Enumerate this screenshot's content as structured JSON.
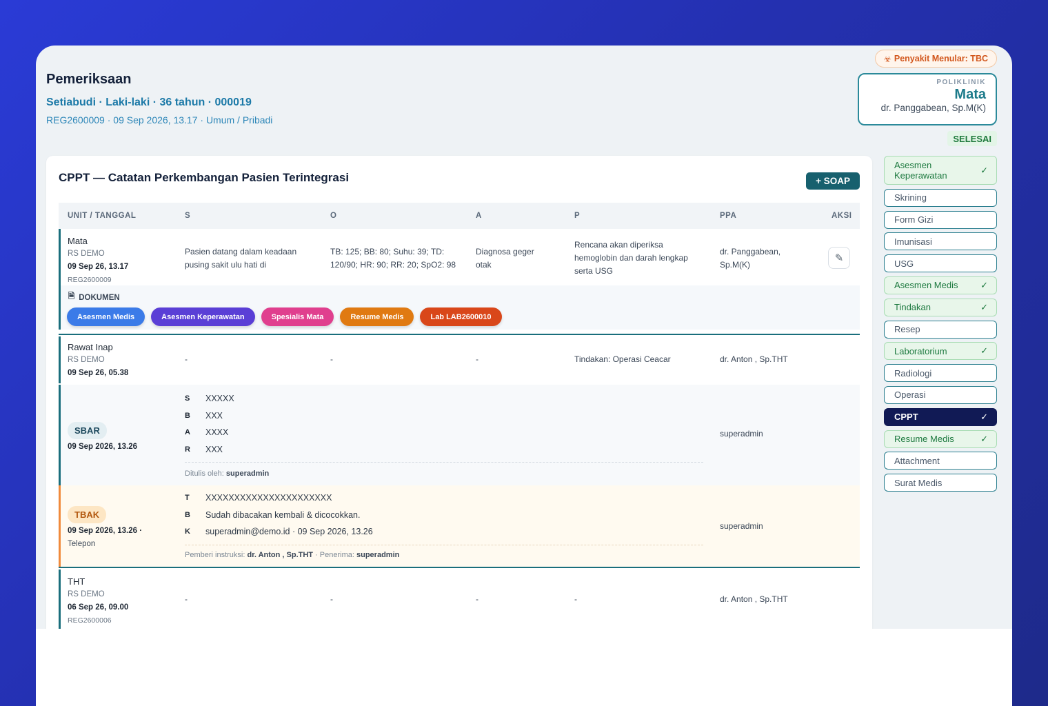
{
  "page": {
    "title": "Pemeriksaan",
    "patient_line": "Setiabudi · Laki-laki · 36 tahun · 000019",
    "reg_line": "REG2600009 · 09 Sep 2026, 13.17 · Umum / Pribadi"
  },
  "header_right": {
    "infection_badge": "Penyakit Menular: TBC",
    "poli_label": "POLIKLINIK",
    "poli_name": "Mata",
    "poli_doctor": "dr. Panggabean, Sp.M(K)",
    "status": "SELESAI"
  },
  "cppt": {
    "title": "CPPT — Catatan Perkembangan Pasien Terintegrasi",
    "soap_button": "+ SOAP",
    "columns": [
      "UNIT / TANGGAL",
      "S",
      "O",
      "A",
      "P",
      "PPA",
      "AKSI"
    ],
    "row1": {
      "unit": "Mata",
      "site": "RS DEMO",
      "date": "09 Sep 26, 13.17",
      "reg": "REG2600009",
      "s": "Pasien datang dalam keadaan pusing sakit ulu hati di",
      "o": "TB: 125; BB: 80; Suhu: 39; TD: 120/90; HR: 90; RR: 20; SpO2: 98",
      "a": "Diagnosa geger otak",
      "p": "Rencana akan diperiksa hemoglobin dan darah lengkap serta USG",
      "ppa": "dr. Panggabean, Sp.M(K)"
    },
    "documents": {
      "label": "DOKUMEN",
      "pills": [
        {
          "label": "Asesmen Medis",
          "color": "#3b7be8"
        },
        {
          "label": "Asesmen Keperawatan",
          "color": "#5a3fd6"
        },
        {
          "label": "Spesialis Mata",
          "color": "#e03f8e"
        },
        {
          "label": "Resume Medis",
          "color": "#e07a12"
        },
        {
          "label": "Lab LAB2600010",
          "color": "#d9471a"
        }
      ]
    },
    "row2": {
      "unit": "Rawat Inap",
      "site": "RS DEMO",
      "date": "09 Sep 26, 05.38",
      "s": "-",
      "o": "-",
      "a": "-",
      "p": "Tindakan: Operasi Ceacar",
      "ppa": "dr. Anton , Sp.THT"
    },
    "sbar": {
      "badge": "SBAR",
      "date": "09 Sep 2026, 13.26",
      "items": [
        {
          "k": "S",
          "v": "XXXXX"
        },
        {
          "k": "B",
          "v": "XXX"
        },
        {
          "k": "A",
          "v": "XXXX"
        },
        {
          "k": "R",
          "v": "XXX"
        }
      ],
      "written_prefix": "Ditulis oleh:",
      "written_by": "superadmin",
      "ppa": "superadmin"
    },
    "tbak": {
      "badge": "TBAK",
      "date": "09 Sep 2026, 13.26 ·",
      "method": "Telepon",
      "items": [
        {
          "k": "T",
          "v": "XXXXXXXXXXXXXXXXXXXXXX"
        },
        {
          "k": "B",
          "v": "Sudah dibacakan kembali & dicocokkan."
        },
        {
          "k": "K",
          "v": "superadmin@demo.id · 09 Sep 2026, 13.26"
        }
      ],
      "instr_prefix": "Pemberi instruksi:",
      "instr_by": "dr. Anton , Sp.THT",
      "recv_prefix": "· Penerima:",
      "recv_by": "superadmin",
      "ppa": "superadmin"
    },
    "row3": {
      "unit": "THT",
      "site": "RS DEMO",
      "date": "06 Sep 26, 09.00",
      "reg": "REG2600006",
      "s": "-",
      "o": "-",
      "a": "-",
      "p": "-",
      "ppa": "dr. Anton , Sp.THT"
    }
  },
  "sidebar": {
    "items": [
      {
        "label": "Asesmen Keperawatan",
        "state": "done",
        "check": "✓"
      },
      {
        "label": "Skrining",
        "state": "normal"
      },
      {
        "label": "Form Gizi",
        "state": "normal"
      },
      {
        "label": "Imunisasi",
        "state": "normal"
      },
      {
        "label": "USG",
        "state": "normal"
      },
      {
        "label": "Asesmen Medis",
        "state": "done",
        "check": "✓"
      },
      {
        "label": "Tindakan",
        "state": "done",
        "check": "✓"
      },
      {
        "label": "Resep",
        "state": "normal"
      },
      {
        "label": "Laboratorium",
        "state": "done",
        "check": "✓"
      },
      {
        "label": "Radiologi",
        "state": "normal"
      },
      {
        "label": "Operasi",
        "state": "normal"
      },
      {
        "label": "CPPT",
        "state": "active",
        "check": "✓"
      },
      {
        "label": "Resume Medis",
        "state": "done",
        "check": "✓"
      },
      {
        "label": "Attachment",
        "state": "normal"
      },
      {
        "label": "Surat Medis",
        "state": "normal"
      }
    ]
  }
}
